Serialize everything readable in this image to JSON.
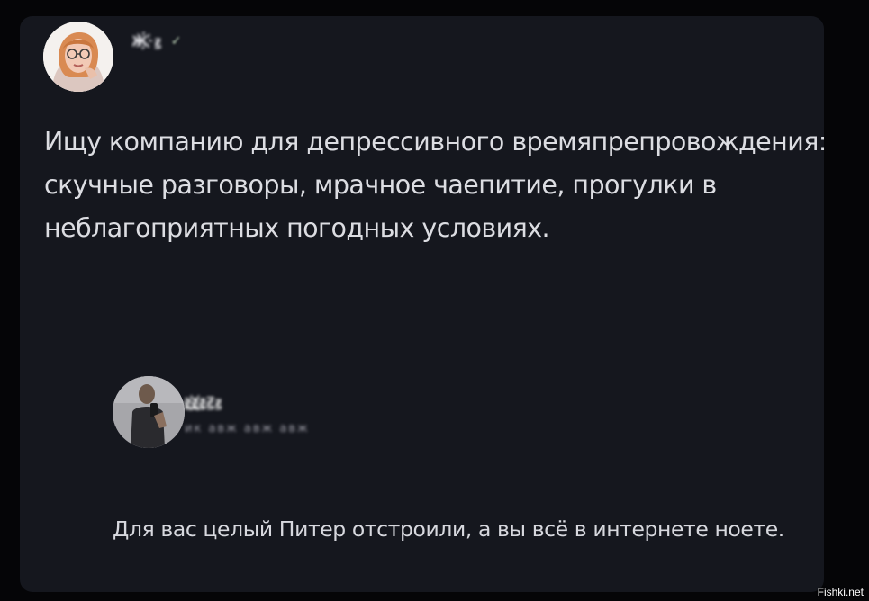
{
  "post": {
    "author_name": "Ж҉ꙃ",
    "author_badge": "✓",
    "text": "Ищу компанию для депрессивного времяпрепровождения: скучные разговоры, мрачное чаепитие, прогулки в неблагоприятных погодных условиях."
  },
  "reply": {
    "author_name": "ꙃ҉ꙃ҉ꙃꙂꙃ",
    "author_handle": "ик авж авж авж",
    "text": "Для вас целый Питер отстроили, а вы всё в интернете ноете."
  },
  "watermark": "Fishki.net",
  "colors": {
    "background": "#050507",
    "card": "#15171e",
    "text": "#dcdde2"
  }
}
